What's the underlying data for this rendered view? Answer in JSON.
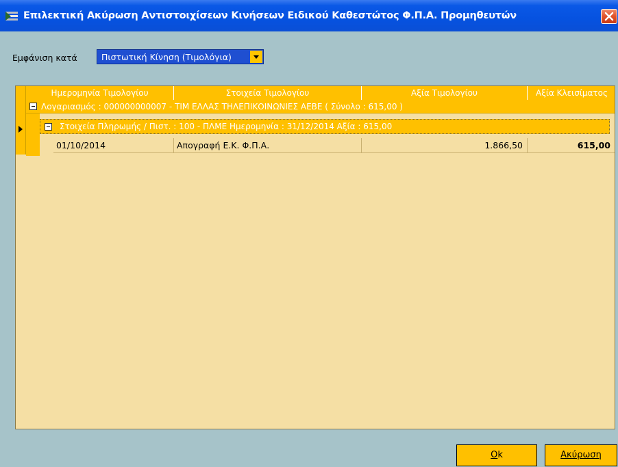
{
  "window": {
    "title": "Επιλεκτική Ακύρωση Αντιστοιχίσεων Κινήσεων Ειδικού Καθεστώτος Φ.Π.Α. Προμηθευτών"
  },
  "view": {
    "label": "Εμφάνιση κατά",
    "selected": "Πιστωτική Κίνηση (Τιμολόγια)"
  },
  "grid": {
    "columns": [
      "Ημερομηνία Τιμολογίου",
      "Στοιχεία Τιμολογίου",
      "Αξία Τιμολογίου",
      "Αξία Κλεισίματος"
    ],
    "group1": "Λογαριασμός : 000000000007 - ΤΙΜ ΕΛΛΑΣ ΤΗΛΕΠΙΚΟΙΝΩΝΙΕΣ ΑΕΒΕ ( Σύνολο : 615,00 )",
    "group2": "Στοιχεία Πληρωμής / Πιστ. : 100 - ΠΛΜΕ Ημερομηνία : 31/12/2014 Αξία : 615,00",
    "rows": [
      {
        "date": "01/10/2014",
        "details": "Απογραφή Ε.Κ. Φ.Π.Α.",
        "invoice_value": "1.866,50",
        "closing_value": "615,00"
      }
    ]
  },
  "buttons": {
    "ok": {
      "first": "O",
      "rest": "k"
    },
    "cancel": {
      "first": "Α",
      "rest": "κύρωση"
    }
  },
  "colors": {
    "titlebar": "#0652e0",
    "grid_header": "#ffc000",
    "grid_body": "#f5dfa4",
    "window_bg": "#a6c3c9"
  }
}
